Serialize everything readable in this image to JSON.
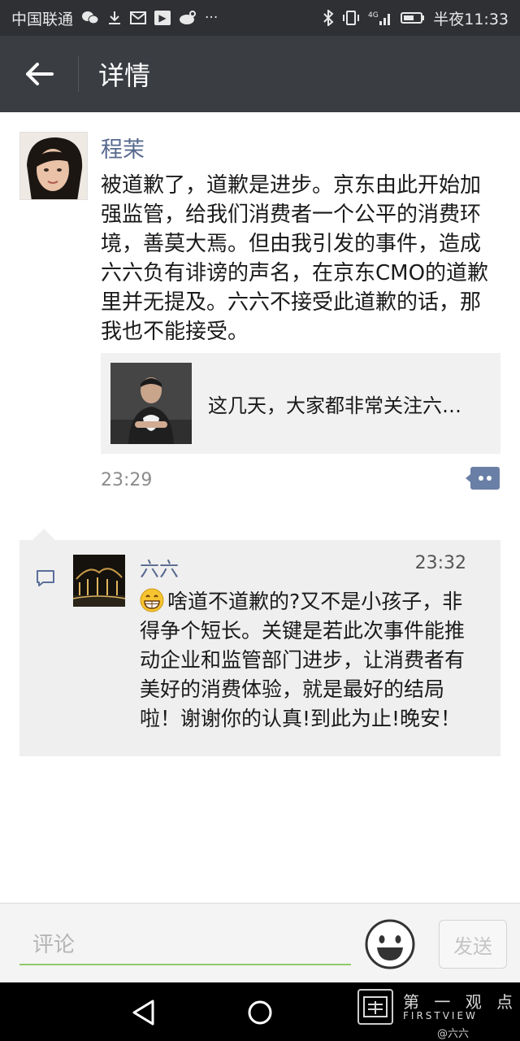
{
  "status_bar": {
    "carrier": "中国联通",
    "network": "4G",
    "time": "半夜11:33"
  },
  "header": {
    "title": "详情"
  },
  "post": {
    "author": "程茉",
    "text": "被道歉了，道歉是进步。京东由此开始加强监管，给我们消费者一个公平的消费环境，善莫大焉。但由我引发的事件，造成六六负有诽谤的声名，在京东CMO的道歉里并无提及。六六不接受此道歉的话，那我也不能接受。",
    "link_card_title": "这几天，大家都非常关注六…",
    "time": "23:29"
  },
  "comment": {
    "author": "六六",
    "time": "23:32",
    "text": "啥道不道歉的?又不是小孩子，非得争个短长。关键是若此次事件能推动企业和监管部门进步，让消费者有美好的消费体验，就是最好的结局啦！谢谢你的认真!到此为止!晚安！"
  },
  "input_bar": {
    "placeholder": "评论",
    "send_label": "发送"
  },
  "watermark": {
    "cn": "第 一 观 点",
    "en": "FIRSTVIEW",
    "weibo": "@六六"
  },
  "colors": {
    "status_bg": "#2e3034",
    "header_bg": "#3a3d42",
    "name_link": "#57688e",
    "comment_bg": "#efefef",
    "input_underline": "#8fcc6a"
  }
}
